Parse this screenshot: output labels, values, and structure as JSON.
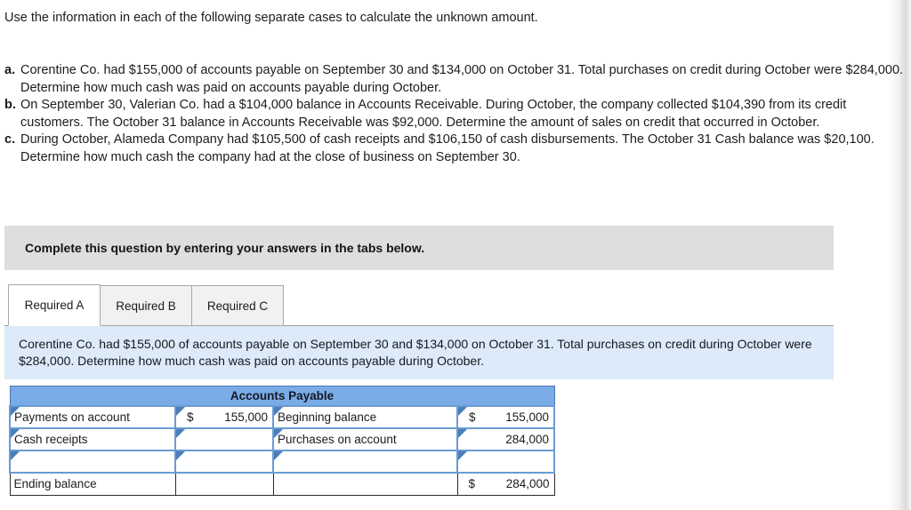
{
  "intro": {
    "text": "Use the information in each of the following separate cases to calculate the unknown amount."
  },
  "cases": [
    {
      "marker": "a.",
      "text": "Corentine Co. had $155,000 of accounts payable on September 30 and $134,000 on October 31. Total purchases on credit during October were $284,000. Determine how much cash was paid on accounts payable during October."
    },
    {
      "marker": "b.",
      "text": "On September 30, Valerian Co. had a $104,000 balance in Accounts Receivable. During October, the company collected $104,390 from its credit customers. The October 31 balance in Accounts Receivable was $92,000. Determine the amount of sales on credit that occurred in October."
    },
    {
      "marker": "c.",
      "text": "During October, Alameda Company had $105,500 of cash receipts and $106,150 of cash disbursements. The October 31 Cash balance was $20,100. Determine how much cash the company had at the close of business on September 30."
    }
  ],
  "instruction_bar": {
    "text": "Complete this question by entering your answers in the tabs below."
  },
  "tabs": [
    {
      "label": "Required A",
      "active": true
    },
    {
      "label": "Required B",
      "active": false
    },
    {
      "label": "Required C",
      "active": false
    }
  ],
  "info_panel": {
    "text": "Corentine Co. had $155,000 of accounts payable on September 30 and $134,000 on October 31. Total purchases on credit during October were $284,000. Determine how much cash was paid on accounts payable during October."
  },
  "t_account": {
    "title": "Accounts Payable",
    "rows": [
      {
        "left_label": "Payments on account",
        "left_currency": "$",
        "left_amount": "155,000",
        "right_label": "Beginning balance",
        "right_currency": "$",
        "right_amount": "155,000"
      },
      {
        "left_label": "Cash receipts",
        "left_currency": "",
        "left_amount": "",
        "right_label": "Purchases on account",
        "right_currency": "",
        "right_amount": "284,000"
      },
      {
        "left_label": "",
        "left_currency": "",
        "left_amount": "",
        "right_label": "",
        "right_currency": "",
        "right_amount": ""
      }
    ],
    "ending_row": {
      "left_label": "Ending balance",
      "left_currency": "",
      "left_amount": "",
      "right_label": "",
      "right_currency": "$",
      "right_amount": "284,000"
    }
  },
  "colors": {
    "header_blue": "#79ace7",
    "info_blue": "#ddeaf9",
    "instruction_gray": "#dedede",
    "cell_border_blue": "#6b9bd2",
    "marker_blue": "#4a7ebb"
  }
}
